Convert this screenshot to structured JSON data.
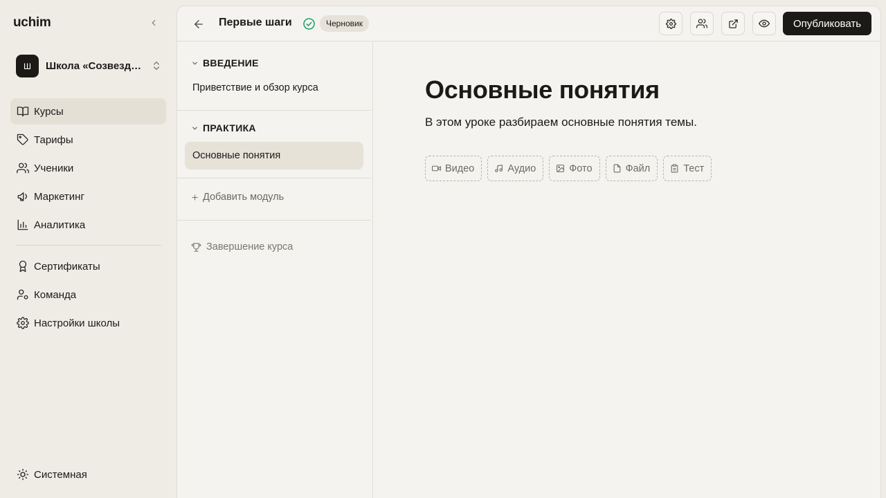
{
  "sidebar": {
    "brand": "uchim",
    "school": {
      "avatar_letter": "Ш",
      "name": "Школа «Созвездие»"
    },
    "nav_main": [
      {
        "label": "Курсы",
        "icon": "book-open-icon",
        "active": true
      },
      {
        "label": "Тарифы",
        "icon": "tag-icon",
        "active": false
      },
      {
        "label": "Ученики",
        "icon": "users-icon",
        "active": false
      },
      {
        "label": "Маркетинг",
        "icon": "megaphone-icon",
        "active": false
      },
      {
        "label": "Аналитика",
        "icon": "bar-chart-icon",
        "active": false
      }
    ],
    "nav_secondary": [
      {
        "label": "Сертификаты",
        "icon": "award-icon"
      },
      {
        "label": "Команда",
        "icon": "user-cog-icon"
      },
      {
        "label": "Настройки школы",
        "icon": "gear-icon"
      }
    ],
    "theme_label": "Системная"
  },
  "header": {
    "course_title": "Первые шаги",
    "status_badge": "Черновик",
    "tool_icons": [
      "gear-icon",
      "users-icon",
      "external-link-icon",
      "eye-icon"
    ],
    "publish_label": "Опубликовать"
  },
  "outline": {
    "modules": [
      {
        "title": "ВВЕДЕНИЕ",
        "lessons": [
          {
            "title": "Приветствие и обзор курса",
            "active": false
          }
        ]
      },
      {
        "title": "ПРАКТИКА",
        "lessons": [
          {
            "title": "Основные понятия",
            "active": true
          }
        ]
      }
    ],
    "add_module_label": "Добавить модуль",
    "finish_label": "Завершение курса"
  },
  "editor": {
    "title": "Основные понятия",
    "description": "В этом уроке разбираем основные понятия темы.",
    "block_buttons": [
      {
        "label": "Видео",
        "icon": "video-icon"
      },
      {
        "label": "Аудио",
        "icon": "music-icon"
      },
      {
        "label": "Фото",
        "icon": "image-icon"
      },
      {
        "label": "Файл",
        "icon": "file-icon"
      },
      {
        "label": "Тест",
        "icon": "clipboard-icon"
      }
    ]
  },
  "colors": {
    "background": "#efece6",
    "panel": "#f4f3ef",
    "active_item": "#e4e0d5",
    "primary_button": "#1c1a17",
    "status_green": "#22a06b"
  }
}
